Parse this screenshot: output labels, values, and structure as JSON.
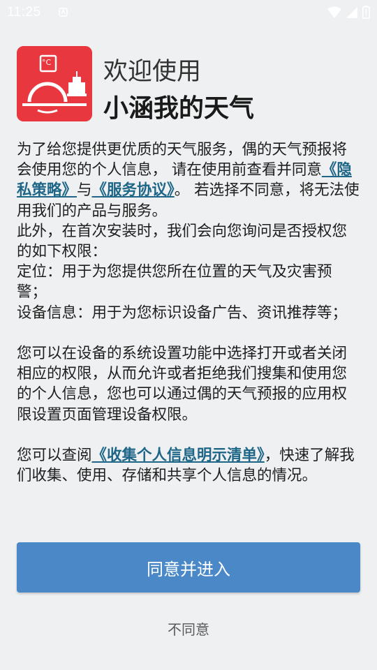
{
  "status_bar": {
    "time": "11:25",
    "icons": [
      "notification-icon",
      "wifi-icon",
      "signal-icon",
      "battery-icon"
    ]
  },
  "header": {
    "logo_icon": "weather-app-logo-icon",
    "logo_text": "°C",
    "welcome": "欢迎使用",
    "app_name": "小涵我的天气"
  },
  "content": {
    "p1_a": "为了给您提供更优质的天气服务，偶的天气预报将会使用您的个人信息， 请在使用前查看并同意",
    "privacy_link": "《隐私策略》",
    "p1_and": "与",
    "service_link": "《服务协议》",
    "p1_b": "。 若选择不同意，将无法使用我们的产品与服务。",
    "p2": "此外，在首次安装时，我们会向您询问是否授权您的如下权限：",
    "p3": "定位：用于为您提供您所在位置的天气及灾害预警；",
    "p4": "设备信息：用于为您标识设备广告、资讯推荐等；",
    "p5": "您可以在设备的系统设置功能中选择打开或者关闭相应的权限，从而允许或者拒绝我们搜集和使用您的个人信息，您也可以通过偶的天气预报的应用权限设置页面管理设备权限。",
    "p6_a": "您可以查阅",
    "collect_link": "《收集个人信息明示清单》",
    "p6_b": "，快速了解我们收集、使用、存储和共享个人信息的情况。"
  },
  "buttons": {
    "agree": "同意并进入",
    "disagree": "不同意"
  },
  "colors": {
    "background": "#eef0f1",
    "primary": "#4a88c7",
    "link": "#1e6688",
    "logo_red": "#e8373f"
  }
}
